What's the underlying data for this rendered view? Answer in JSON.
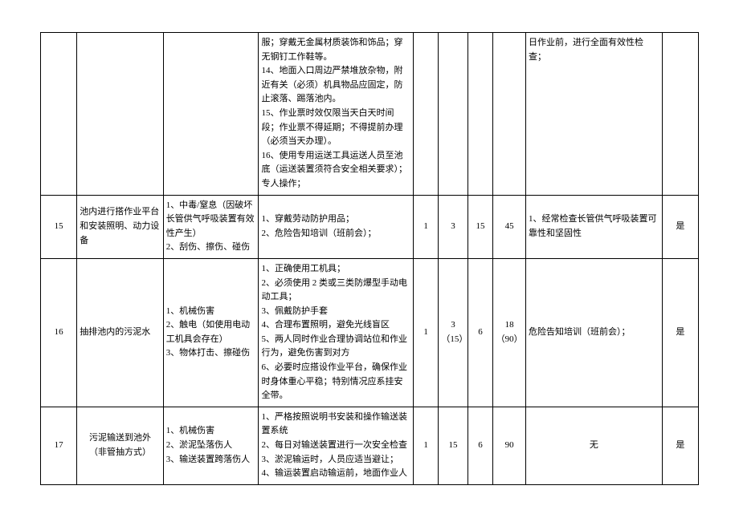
{
  "rows": [
    {
      "idx": "",
      "task": "",
      "risk": "",
      "measure": "服；穿戴无金属材质装饰和饰品；穿无钢钉工作鞋等。\n14、地面入口周边严禁堆放杂物，附近有关（必须）机具物品应固定，防止滚落、踢落池内。\n15、作业票时效仅限当天白天时间段；作业票不得延期；不得提前办理（必须当天办理）。\n16、使用专用运送工具运送人员至池底（运送装置须符合安全相关要求）；专人操作；",
      "n1": "",
      "n2": "",
      "n3": "",
      "n4": "",
      "extra": "日作业前，进行全面有效性检查；",
      "yes": ""
    },
    {
      "idx": "15",
      "task": "池内进行搭作业平台和安装照明、动力设备",
      "risk": "1、中毒/窒息（因破坏长管供气呼吸装置有效性产生）\n2、刮伤、擦伤、碰伤",
      "measure": "1、穿戴劳动防护用品；\n2、危险告知培训（班前会）；",
      "n1": "1",
      "n2": "3",
      "n3": "15",
      "n4": "45",
      "extra": "1、经常检查长管供气呼吸装置可靠性和坚固性",
      "yes": "是"
    },
    {
      "idx": "16",
      "task": "抽排池内的污泥水",
      "risk": "1、机械伤害\n2、触电（如使用电动工机具会存在）\n3、物体打击、擦碰伤",
      "measure": "1、正确使用工机具；\n2、必须使用 2 类或三类防爆型手动电动工具；\n3、佩戴防护手套\n4、合理布置照明，避免光线盲区\n5、两人同时作业合理协调站位和作业行为，避免伤害到对方\n6、必要时应搭设作业平台，确保作业时身体重心平稳；特别情况应系挂安全带。",
      "n1": "1",
      "n2": "3\n（15）",
      "n3": "6",
      "n4": "18\n（90）",
      "extra": "危险告知培训（班前会）；",
      "yes": "是"
    },
    {
      "idx": "17",
      "task": "污泥输送到池外\n（非管抽方式）",
      "risk": "1、机械伤害\n2、淤泥坠落伤人\n3、输送装置跨落伤人",
      "measure": "1、严格按照说明书安装和操作输送装置系统\n2、每日对输送装置进行一次安全检查\n3、淤泥输运时，人员应适当避让；\n4、输运装置启动输运前，地面作业人",
      "n1": "1",
      "n2": "15",
      "n3": "6",
      "n4": "90",
      "extra": "无",
      "yes": "是"
    }
  ]
}
